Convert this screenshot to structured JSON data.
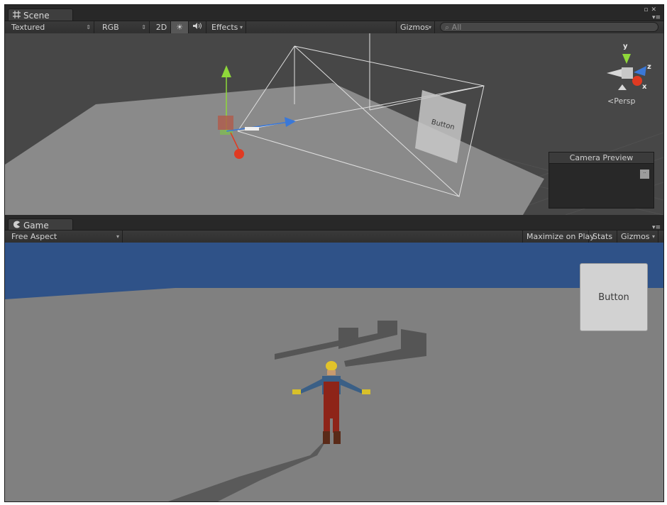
{
  "scene": {
    "tab_label": "Scene",
    "tab_icon": "scene-grid-icon",
    "toolbar": {
      "draw_mode": "Textured",
      "render_mode": "RGB",
      "mode_2d": "2D",
      "lighting_icon": "sun-icon",
      "audio_icon": "speaker-icon",
      "effects": "Effects",
      "gizmos": "Gizmos",
      "search_placeholder": "All"
    },
    "projection": "Persp",
    "orientation_gizmo": {
      "y": "y",
      "z": "z",
      "x": "x"
    },
    "world_button_label": "Button",
    "camera_preview": {
      "title": "Camera Preview"
    }
  },
  "game": {
    "tab_label": "Game",
    "tab_icon": "pacman-icon",
    "toolbar": {
      "aspect": "Free Aspect",
      "maximize_on_play": "Maximize on Play",
      "stats": "Stats",
      "gizmos": "Gizmos"
    },
    "ui_button_label": "Button"
  },
  "colors": {
    "sky": "#2f5288",
    "ground": "#808080",
    "panel_bg": "#282828",
    "scene_bg": "#474747",
    "gizmo_y": "#8fd83a",
    "gizmo_z": "#3a78d8",
    "gizmo_x": "#e03a22"
  }
}
